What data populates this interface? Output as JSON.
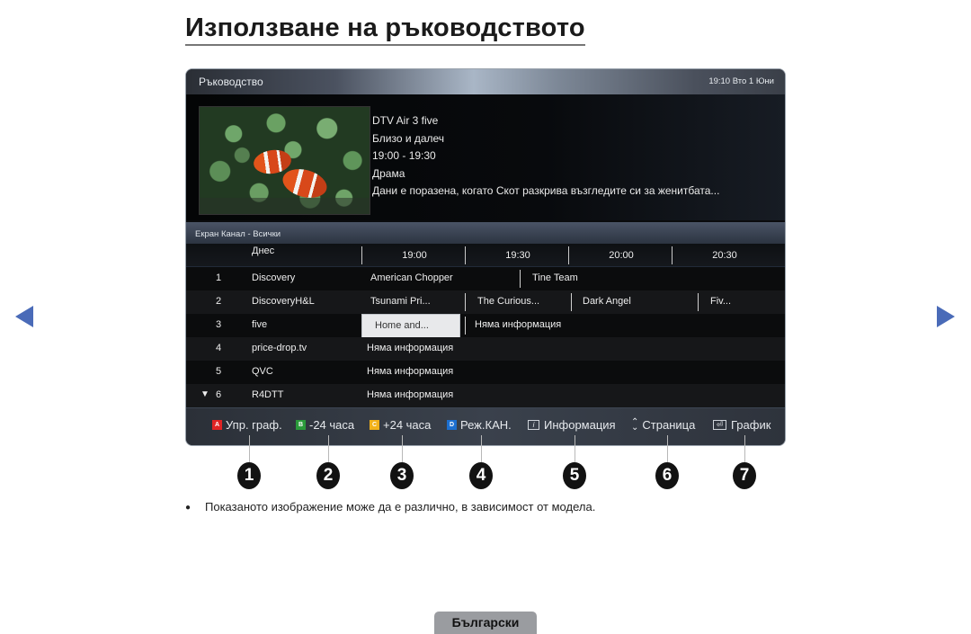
{
  "page": {
    "title": "Използване на ръководството",
    "note": "Показаното изображение може да е различно, в зависимост от модела.",
    "language_tab": "Български",
    "nav": {
      "prev_icon": "triangle-left",
      "next_icon": "triangle-right",
      "color": "#4a6bb8"
    }
  },
  "guide": {
    "header_title": "Ръководство",
    "clock": "19:10 Вто 1 Юни",
    "info": {
      "channel": "DTV Air 3 five",
      "program": "Близо и далеч",
      "time": "19:00 - 19:30",
      "genre": "Драма",
      "description": "Дани е поразена, когато Скот разкрива възгледите си за женитбата..."
    },
    "filter": "Екран Канал - Всички",
    "time_header": {
      "today": "Днес",
      "slots": [
        "19:00",
        "19:30",
        "20:00",
        "20:30"
      ]
    },
    "rows": [
      {
        "num": "1",
        "channel": "Discovery",
        "programs": [
          "American Chopper",
          "Tine Team"
        ]
      },
      {
        "num": "2",
        "channel": "DiscoveryH&L",
        "programs": [
          "Tsunami Pri...",
          "The Curious...",
          "Dark Angel",
          "Fiv..."
        ]
      },
      {
        "num": "3",
        "channel": "five",
        "programs": [
          "Home and...",
          "Няма информация"
        ],
        "selected": "Home and..."
      },
      {
        "num": "4",
        "channel": "price-drop.tv",
        "programs": [
          "Няма информация"
        ]
      },
      {
        "num": "5",
        "channel": "QVC",
        "programs": [
          "Няма информация"
        ]
      },
      {
        "num": "6",
        "channel": "R4DTT",
        "programs": [
          "Няма информация"
        ],
        "scroll_indicator": "▼"
      }
    ],
    "footer": [
      {
        "key": "A",
        "color": "#e02424",
        "label": "Упр. граф."
      },
      {
        "key": "B",
        "color": "#2a9a3a",
        "label": "-24 часа"
      },
      {
        "key": "C",
        "color": "#f2b21a",
        "label": "+24 часа"
      },
      {
        "key": "D",
        "color": "#1c6fd0",
        "label": "Реж.КАН."
      },
      {
        "icon": "info-icon",
        "glyph": "i",
        "label": "Информация"
      },
      {
        "icon": "page-updown-icon",
        "glyph": "⌃⌄",
        "label": "Страница"
      },
      {
        "icon": "schedule-icon",
        "glyph": "⏎",
        "label": "График"
      }
    ]
  },
  "callouts": [
    "1",
    "2",
    "3",
    "4",
    "5",
    "6",
    "7"
  ]
}
